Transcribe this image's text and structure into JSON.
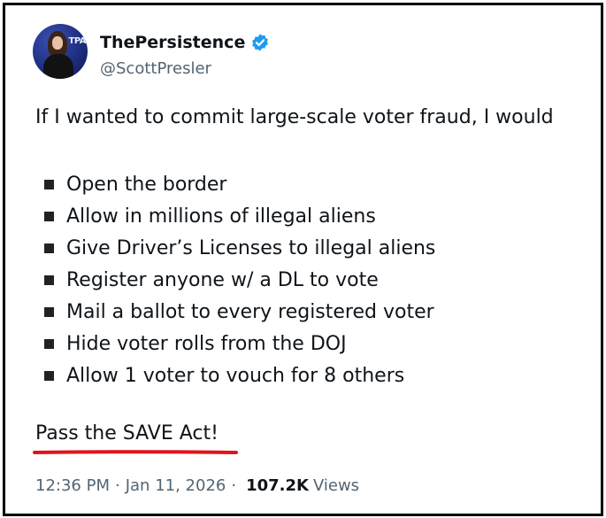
{
  "author": {
    "display_name": "ThePersistence",
    "handle": "@ScottPresler",
    "avatar_banner_text": "TPA",
    "verified_icon": "verified-badge-icon"
  },
  "tweet": {
    "intro": "If I wanted to commit large-scale voter fraud, I would",
    "bullets": [
      "Open the border",
      "Allow in millions of illegal aliens",
      "Give Driver’s Licenses to illegal aliens",
      "Register anyone w/ a DL to vote",
      "Mail a ballot to every registered voter",
      "Hide voter rolls from the DOJ",
      "Allow 1 voter to vouch for 8 others"
    ],
    "call_to_action": "Pass the SAVE Act!"
  },
  "meta": {
    "time": "12:36 PM",
    "separator": "·",
    "date": "Jan 11, 2026",
    "views_count": "107.2K",
    "views_label": "Views"
  },
  "colors": {
    "text": "#0f1419",
    "secondary": "#536471",
    "verified": "#1d9bf0",
    "underline": "#e0141e",
    "frame": "#000000"
  }
}
